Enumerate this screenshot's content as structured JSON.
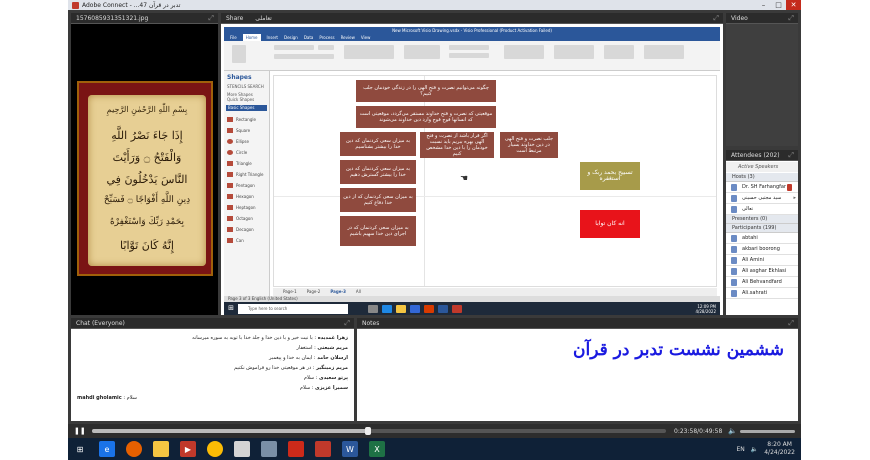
{
  "window": {
    "title": "Adobe Connect - ...تدبر در قرآن 47"
  },
  "image_pod": {
    "title": "1576085931351321.jpg",
    "bism": "بِسْمِ اللّٰهِ الرَّحْمٰنِ الرَّحِيمِ",
    "lines": [
      "إِذَا جَاءَ نَصْرُ اللَّهِ",
      "وَالْفَتْحُ ۝ وَرَأَيْتَ",
      "النَّاسَ يَدْخُلُونَ فِي",
      "دِينِ اللَّهِ أَفْوَاجًا ۝ فَسَبِّحْ",
      "بِحَمْدِ رَبِّكَ وَاسْتَغْفِرْهُ",
      "إِنَّهُ كَانَ تَوَّابًا"
    ]
  },
  "share_pod": {
    "title": "Share",
    "title_suffix": "تعاملی",
    "app_title": "New Microsoft Visio Drawing.vsdx - Visio Professional (Product Activation Failed)",
    "ribbon_tabs": [
      "File",
      "Home",
      "Insert",
      "Design",
      "Data",
      "Process",
      "Review",
      "View"
    ],
    "shapes": {
      "title": "Shapes",
      "tabs": "STENCILS    SEARCH",
      "more": "More Shapes",
      "quick": "Quick Shapes",
      "basic": "Basic Shapes",
      "items": [
        "Rectangle",
        "Square",
        "Ellipse",
        "Circle",
        "Triangle",
        "Right Triangle",
        "Pentagon",
        "Hexagon",
        "Heptagon",
        "Octagon",
        "Decagon",
        "Can"
      ]
    },
    "boxes": {
      "q1": "چگونه می‌توانیم نصرت و فتح الهی را در زندگی خودمان جلب کنیم؟",
      "q2": "موقعیتی که نصرت و فتح خداوند مستقر می‌گردد، موقعیتی است که انسانها فوج فوج وارد دین خداوند می‌شوند",
      "r1": "به میزان سعی کردنمان که دین خدا را بیشتر بشناسیم",
      "r2": "به میزان سعی کردنمان که دین خدا را بیشتر گسترش دهیم",
      "r3": "به میزان سعی کردنمان که از دین خدا دفاع کنیم",
      "r4": "به میزان سعی کردنمان که در اجرای دین خدا سهیم باشیم",
      "m1": "اگر قرار باشد از نصرت و فتح الهی بهره ببریم باید نسبت خودمان را با دین خدا مشخص کنیم",
      "m2": "جلب نصرت و فتح الهی در دین خداوند بسیار مرتبط است",
      "olive": "تسبیح بحمد ربک و استغفره",
      "red": "انه کان توابا"
    },
    "pages": [
      "Page-1",
      "Page-2",
      "Page-3",
      "All"
    ],
    "page_active": "Page-3",
    "status": "Page 3 of 3    English (United States)",
    "search_placeholder": "Type here to search",
    "clock": {
      "time": "12:09 PM",
      "date": "4/28/2022"
    }
  },
  "video_pod": {
    "title": "Video"
  },
  "attendees": {
    "title": "Attendees",
    "count": "(202)",
    "active_speakers": "Active Speakers",
    "hosts_label": "Hosts (3)",
    "hosts": [
      "Dr. SH Farhangfar",
      "سید مجتبی حسینی",
      "تعالی"
    ],
    "presenters_label": "Presenters (0)",
    "participants_label": "Participants (199)",
    "participants": [
      "abtahi",
      "akbari boorong",
      "Ali Amini",
      "Ali asghar Ekhlasi",
      "Ali Behvandfard",
      "Ali.sahrati"
    ]
  },
  "chat": {
    "title": "Chat",
    "scope": "(Everyone)",
    "messages": [
      {
        "name": "زهرا غمدیده",
        "text": "با نیت خیر و با دین خدا و جلد خدا با توبه به سوره میرسانه"
      },
      {
        "name": "مریم شیعتی",
        "text": "استغفار"
      },
      {
        "name": "ارسلان حامد",
        "text": "ایمان به خدا و پیغمبر"
      },
      {
        "name": "مریم زمینگیر",
        "text": "در هر موقعیتی خدا رو فراموش نکنیم"
      },
      {
        "name": "پرتو سعیدی",
        "text": "سلام"
      },
      {
        "name": "سمیرا عزیزی",
        "text": "سلام"
      },
      {
        "name": "mahdi gholamic",
        "text": "سلام"
      }
    ]
  },
  "notes": {
    "title": "Notes",
    "text": "ششمین نشست تدبر در قرآن"
  },
  "playback": {
    "time": "0:23:58/0:49:58",
    "progress": 0.48
  },
  "taskbar": {
    "lang": "EN",
    "time": "8:20 AM",
    "date": "4/24/2022"
  },
  "colors": {
    "box": "#8f4a3e",
    "olive": "#a79b4a",
    "red": "#e8131a",
    "notes": "#1a1ae0",
    "visio": "#2b579a"
  }
}
